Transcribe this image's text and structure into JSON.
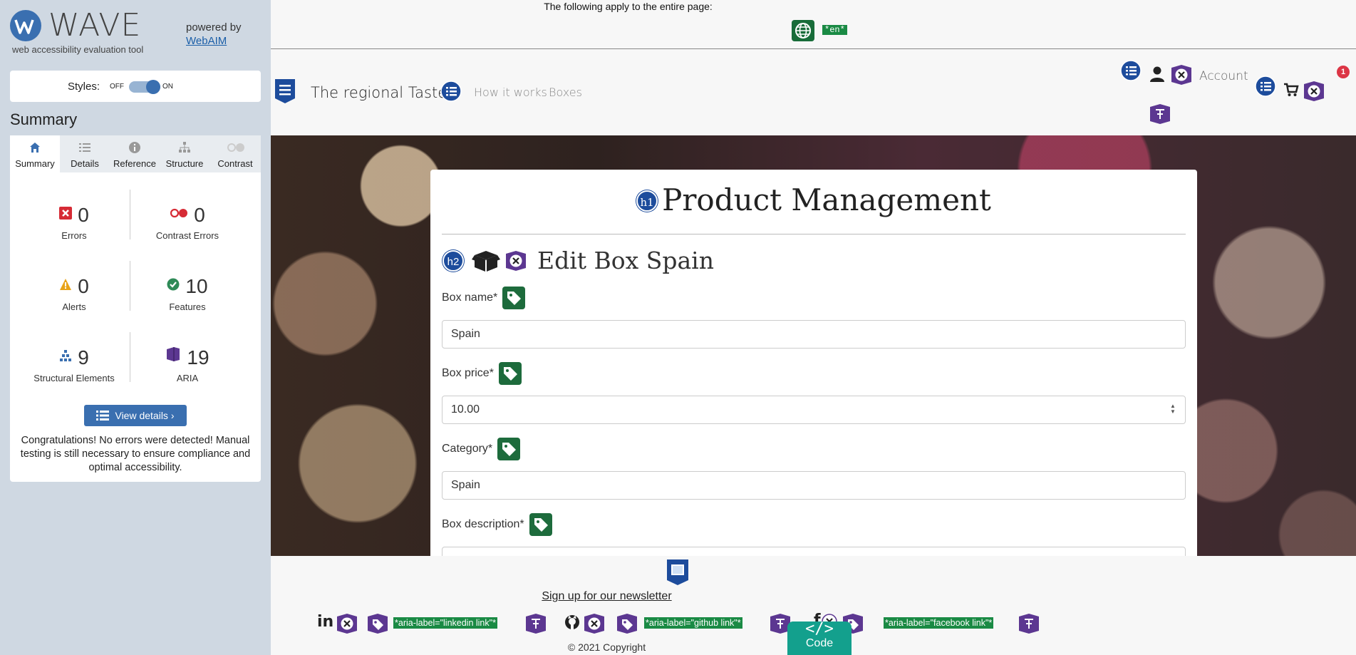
{
  "sidebar": {
    "logo_word": "WAVE",
    "tagline": "web accessibility evaluation tool",
    "powered_by": "powered by",
    "webaim_link": "WebAIM",
    "styles": {
      "label": "Styles:",
      "off": "OFF",
      "on": "ON",
      "enabled": true
    },
    "summary_heading": "Summary",
    "tabs": [
      {
        "label": "Summary",
        "icon": "home-icon",
        "active": true
      },
      {
        "label": "Details",
        "icon": "list-icon"
      },
      {
        "label": "Reference",
        "icon": "info-icon"
      },
      {
        "label": "Structure",
        "icon": "structure-icon"
      },
      {
        "label": "Contrast",
        "icon": "contrast-icon",
        "disabled": true
      }
    ],
    "stats": [
      {
        "value": "0",
        "label": "Errors",
        "color": "#d62b35"
      },
      {
        "value": "0",
        "label": "Contrast Errors",
        "color": "#d62b35"
      },
      {
        "value": "0",
        "label": "Alerts",
        "color": "#e8a319"
      },
      {
        "value": "10",
        "label": "Features",
        "color": "#2e8a57"
      },
      {
        "value": "9",
        "label": "Structural Elements",
        "color": "#3a6fb0"
      },
      {
        "value": "19",
        "label": "ARIA",
        "color": "#5c3791"
      }
    ],
    "view_details": "View details ›",
    "congrats": "Congratulations! No errors were detected! Manual testing is still necessary to ensure compliance and optimal accessibility."
  },
  "page_note": {
    "text": "The following apply to the entire page:",
    "lang": "*en*"
  },
  "navbar": {
    "brand": "The regional Taste",
    "links": [
      "How it works",
      "Boxes"
    ],
    "account": "Account",
    "cart_count": "1"
  },
  "card": {
    "h1": "Product Management",
    "h1_badge": "h1",
    "h2": "Edit Box Spain",
    "h2_badge": "h2",
    "fields": [
      {
        "label": "Box name*",
        "value": "Spain"
      },
      {
        "label": "Box price*",
        "value": "10.00"
      },
      {
        "label": "Category*",
        "value": "Spain"
      },
      {
        "label": "Box description*",
        "value": ""
      }
    ]
  },
  "footer": {
    "newsletter": "Sign up for our newsletter",
    "aria_labels": [
      "*aria-label=\"linkedin link\"*",
      "*aria-label=\"github link\"*",
      "*aria-label=\"facebook link\"*"
    ],
    "copyright": "© 2021 Copyright",
    "code_button": "Code",
    "code_icon": "</>"
  },
  "colors": {
    "wave_blue": "#3a6fb0",
    "feature_green": "#1d6b3c",
    "aria_purple": "#5c3791",
    "heading_blue": "#1d4c9c",
    "code_teal": "#13a08d"
  }
}
